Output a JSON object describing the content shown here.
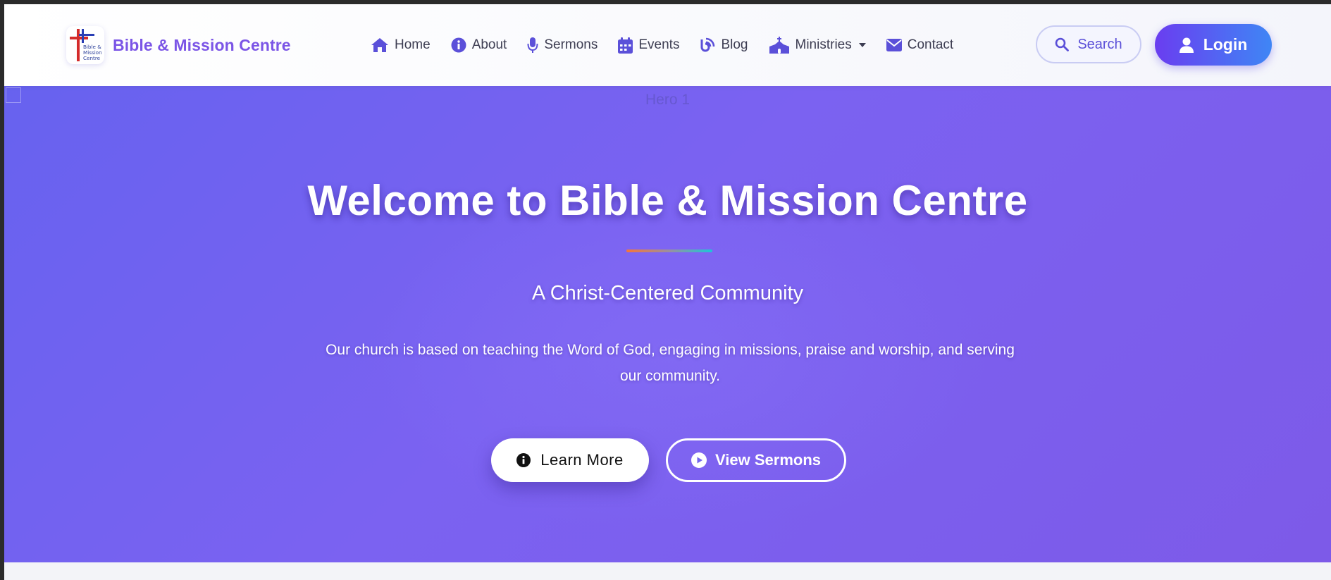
{
  "brand": {
    "name": "Bible & Mission Centre",
    "logo_text": [
      "Bible &",
      "Mission",
      "Centre"
    ]
  },
  "nav": {
    "items": [
      {
        "label": "Home",
        "icon": "home-icon"
      },
      {
        "label": "About",
        "icon": "info-circle-icon"
      },
      {
        "label": "Sermons",
        "icon": "microphone-icon"
      },
      {
        "label": "Events",
        "icon": "calendar-icon"
      },
      {
        "label": "Blog",
        "icon": "blog-icon"
      },
      {
        "label": "Ministries",
        "icon": "church-icon",
        "has_dropdown": true
      },
      {
        "label": "Contact",
        "icon": "envelope-icon"
      }
    ],
    "search_label": "Search",
    "login_label": "Login"
  },
  "hero": {
    "image_alt": "Hero 1",
    "title": "Welcome to Bible & Mission Centre",
    "subtitle": "A Christ-Centered Community",
    "description": "Our church is based on teaching the Word of God, engaging in missions, praise and worship, and serving our community.",
    "primary_button": "Learn More",
    "secondary_button": "View Sermons"
  },
  "colors": {
    "brand_purple": "#7b55e6",
    "hero_start": "#6762ef",
    "hero_end": "#7d5ae8",
    "login_gradient_start": "#6a3df0",
    "login_gradient_end": "#3f86f5",
    "nav_icon": "#5b50d9"
  }
}
